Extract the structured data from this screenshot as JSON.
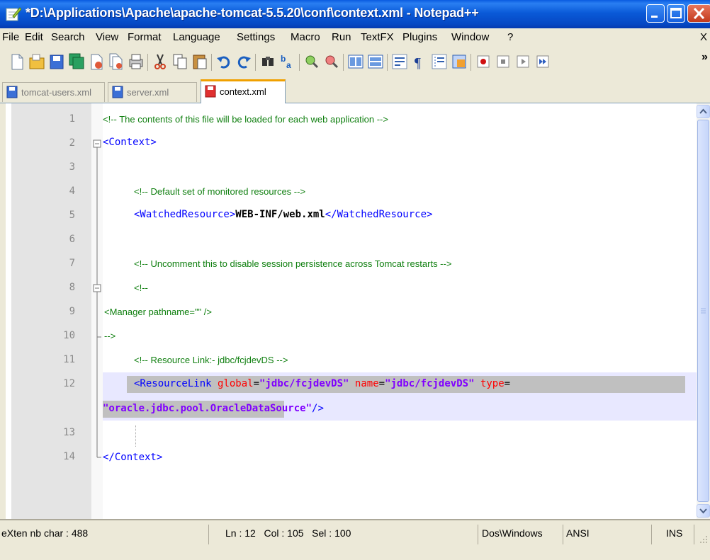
{
  "window": {
    "title": "*D:\\Applications\\Apache\\apache-tomcat-5.5.20\\conf\\context.xml - Notepad++",
    "title_bar_color": "#0a5ad8"
  },
  "menu": {
    "items": [
      "File",
      "Edit",
      "Search",
      "View",
      "Format",
      "Language",
      "Settings",
      "Macro",
      "Run",
      "TextFX",
      "Plugins",
      "Window",
      "?"
    ],
    "close": "X"
  },
  "toolbar": {
    "icons": [
      "new-file-icon",
      "open-file-icon",
      "save-icon",
      "save-all-icon",
      "close-icon",
      "close-all-icon",
      "print-icon",
      "cut-icon",
      "copy-icon",
      "paste-icon",
      "undo-icon",
      "redo-icon",
      "find-icon",
      "replace-icon",
      "zoom-in-icon",
      "zoom-out-icon",
      "sync-vertical-icon",
      "sync-horizontal-icon",
      "word-wrap-icon",
      "show-all-chars-icon",
      "indent-guide-icon",
      "user-lang-icon",
      "record-macro-icon",
      "stop-record-icon",
      "play-macro-icon",
      "run-macro-multiple-icon"
    ],
    "more": "»"
  },
  "tabs": [
    {
      "label": "tomcat-users.xml",
      "active": false
    },
    {
      "label": "server.xml",
      "active": false
    },
    {
      "label": "context.xml",
      "active": true
    }
  ],
  "editor": {
    "line_numbers": [
      "1",
      "2",
      "3",
      "4",
      "5",
      "6",
      "7",
      "8",
      "9",
      "10",
      "11",
      "",
      "12",
      "13",
      "14"
    ],
    "lines": {
      "l1": "<!-- The contents of this file will be loaded for each web application -->",
      "l2": "<Context>",
      "l4": "<!-- Default set of monitored resources -->",
      "l5_open": "<WatchedResource>",
      "l5_text": "WEB-INF/web.xml",
      "l5_close": "</WatchedResource>",
      "l7": "<!-- Uncomment this to disable session persistence across Tomcat restarts -->",
      "l8": "<!--",
      "l9": "<Manager pathname=\"\" />",
      "l10": "-->",
      "l11": "<!-- Resource Link:- jdbc/fcjdevDS -->",
      "l12_tag": "<ResourceLink",
      "l12_attr1": "global",
      "l12_eq": "=",
      "l12_val1": "\"jdbc/fcjdevDS\"",
      "l12_attr2": "name",
      "l12_val2": "\"jdbc/fcjdevDS\"",
      "l12_attr3": "type",
      "l12_cont_val": "\"oracle.jdbc.pool.OracleDataSource\"",
      "l12_cont_end": "/>",
      "l14": "</Context>"
    },
    "colors": {
      "tag": "#0000ff",
      "attr": "#ff0000",
      "value": "#8000ff",
      "comment": "#0f7f0f",
      "current_line": "#e8e8ff"
    }
  },
  "status": {
    "length": "eXten nb char : 488",
    "position": "Ln : 12   Col : 105   Sel : 100",
    "eol": "Dos\\Windows",
    "encoding": "ANSI",
    "mode": "INS"
  }
}
